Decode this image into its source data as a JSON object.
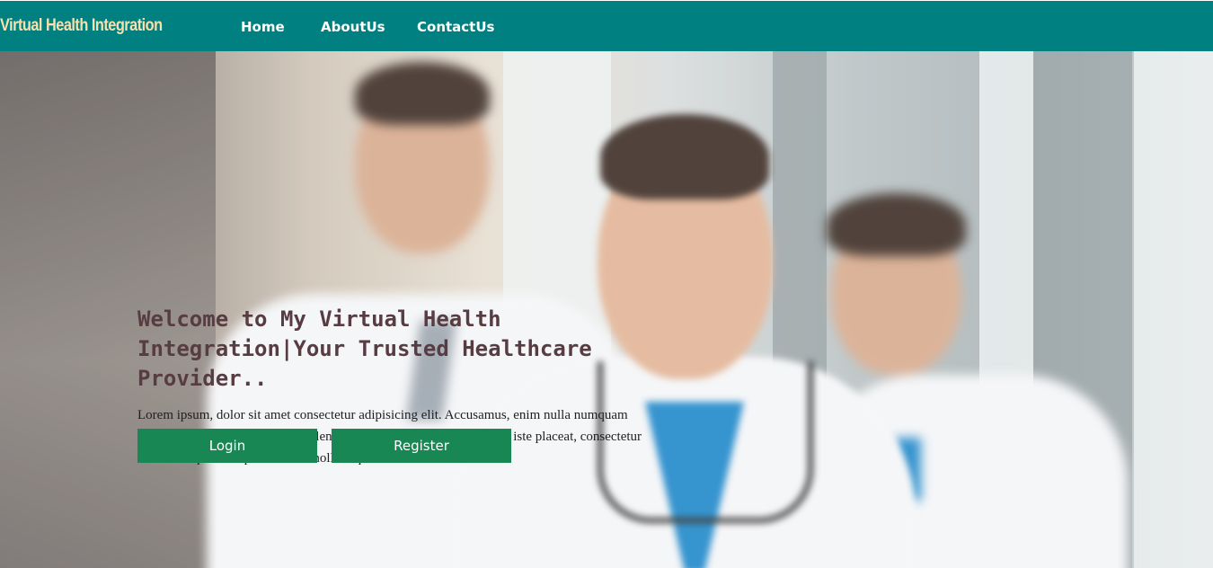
{
  "navbar": {
    "brand": "Virtual Health Integration",
    "links": [
      {
        "label": "Home"
      },
      {
        "label": "AboutUs"
      },
      {
        "label": "ContactUs"
      }
    ]
  },
  "hero": {
    "title": "Welcome to My Virtual Health Integration|Your Trusted Healthcare Provider..",
    "text": "Lorem ipsum, dolor sit amet consectetur adipisicing elit. Accusamus, enim nulla numquam nesciunt optio quaerat quos repellendus obcaecati tenetur temporibus iste placeat, consectetur reiciendis qui in culpa ducimus mollitia quia?",
    "login_label": "Login",
    "register_label": "Register"
  },
  "colors": {
    "navbar": "#008080",
    "brand": "#f3e2b0",
    "button": "#198754",
    "title": "#573c42"
  }
}
